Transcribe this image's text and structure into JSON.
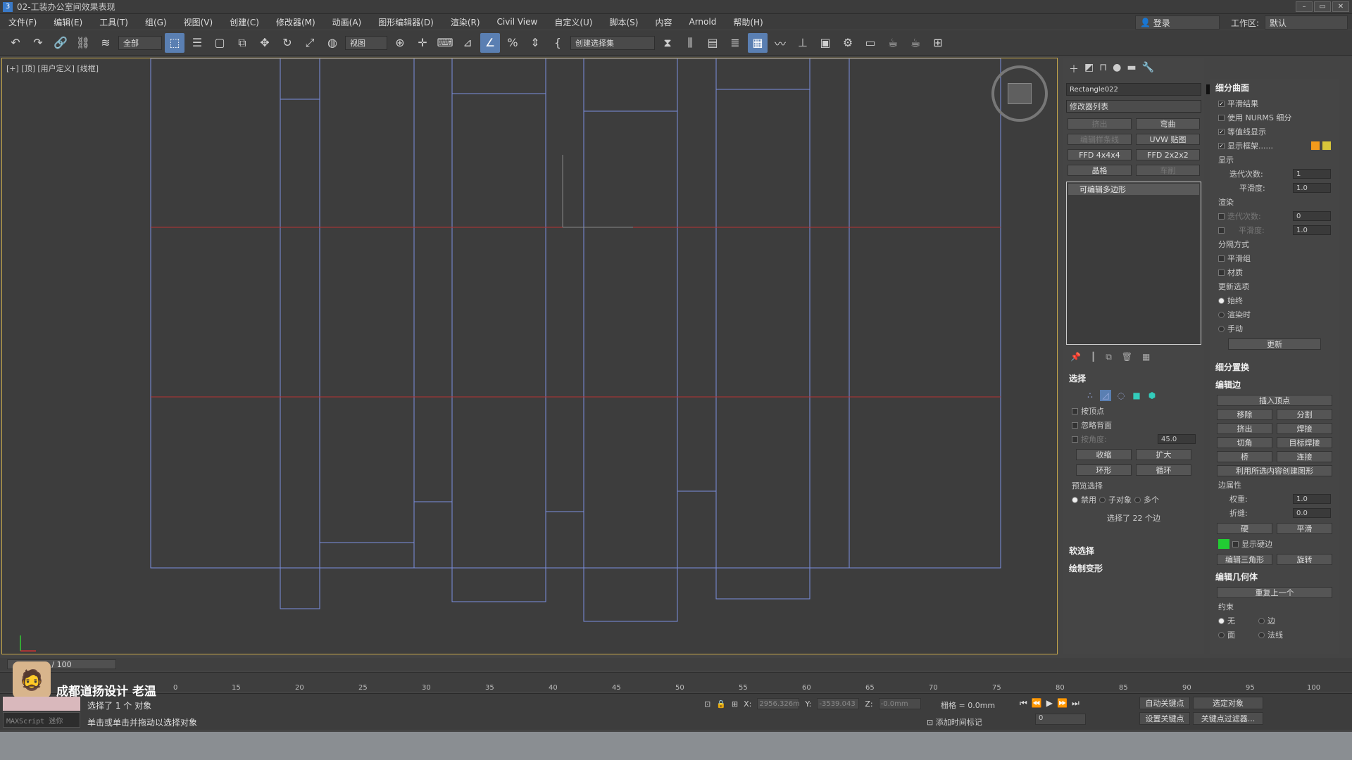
{
  "window": {
    "title": "02-工装办公室间效果表现",
    "app_icon": "3"
  },
  "menu": [
    "文件(F)",
    "编辑(E)",
    "工具(T)",
    "组(G)",
    "视图(V)",
    "创建(C)",
    "修改器(M)",
    "动画(A)",
    "图形编辑器(D)",
    "渲染(R)",
    "Civil View",
    "自定义(U)",
    "脚本(S)",
    "内容",
    "Arnold",
    "帮助(H)"
  ],
  "account": {
    "login": "登录",
    "workspace_label": "工作区:",
    "workspace_value": "默认"
  },
  "toolbar": {
    "filter": "全部",
    "refcoord": "视图",
    "named_selset": "创建选择集"
  },
  "viewport": {
    "label": "[+] [顶] [用户定义] [线框]"
  },
  "modify_panel": {
    "object_name": "Rectangle022",
    "modifier_list": "修改器列表",
    "buttons": [
      "挤出",
      "弯曲",
      "编辑样条线",
      "UVW 贴图",
      "FFD 4x4x4",
      "FFD 2x2x2",
      "晶格",
      "车削"
    ],
    "stack_item": "可编辑多边形"
  },
  "selection": {
    "title": "选择",
    "by_vertex": "按顶点",
    "ignore_backface": "忽略背面",
    "by_angle": "按角度:",
    "angle_value": "45.0",
    "shrink": "收缩",
    "grow": "扩大",
    "ring": "环形",
    "loop": "循环",
    "preview": "预览选择",
    "opt_disable": "禁用",
    "opt_subobj": "子对象",
    "opt_multi": "多个",
    "status": "选择了 22 个边"
  },
  "soft_select": "软选择",
  "paint_deform": "绘制变形",
  "subdiv": {
    "title": "细分曲面",
    "smooth_result": "平滑结果",
    "use_nurms": "使用 NURMS 细分",
    "isoline": "等值线显示",
    "show_cage": "显示框架......",
    "display": "显示",
    "iterations": "迭代次数:",
    "iter_value": "1",
    "smoothness": "平滑度:",
    "smooth_value": "1.0",
    "render": "渲染",
    "r_iter_value": "0",
    "r_smooth_value": "1.0",
    "sep_by": "分隔方式",
    "smooth_groups": "平滑组",
    "materials": "材质",
    "update_opts": "更新选项",
    "always": "始终",
    "when_render": "渲染时",
    "manual": "手动",
    "update_btn": "更新"
  },
  "subdiv_displace": "细分置换",
  "edit_edges": {
    "title": "编辑边",
    "insert_vertex": "插入顶点",
    "remove": "移除",
    "split": "分割",
    "extrude": "挤出",
    "weld": "焊接",
    "chamfer": "切角",
    "target_weld": "目标焊接",
    "bridge": "桥",
    "connect": "连接",
    "create_shape": "利用所选内容创建图形",
    "edge_props": "边属性",
    "weight": "权重:",
    "weight_value": "1.0",
    "crease": "折缝:",
    "crease_value": "0.0",
    "hard": "硬",
    "smooth": "平滑",
    "show_hard": "显示硬边",
    "edit_tri": "编辑三角形",
    "turn": "旋转"
  },
  "edit_geom": {
    "title": "编辑几何体",
    "repeat_last": "重复上一个",
    "constraints": "约束",
    "none": "无",
    "edge": "边",
    "face": "面",
    "normal": "法线"
  },
  "timeline": {
    "slider": "/ 100",
    "ticks": [
      "0",
      "15",
      "20",
      "25",
      "30",
      "35",
      "40",
      "45",
      "50",
      "55",
      "60",
      "65",
      "70",
      "75",
      "80",
      "85",
      "90",
      "95",
      "100"
    ]
  },
  "status": {
    "brand": "成都道扬设计  老温",
    "selected": "选择了 1 个 对象",
    "prompt": "单击或单击并拖动以选择对象",
    "maxscript": "MAXScript 迷你",
    "x_label": "X:",
    "x_value": "2956.326m",
    "y_label": "Y:",
    "y_value": "-3539.043",
    "z_label": "Z:",
    "z_value": "-0.0mm",
    "grid": "栅格 = 0.0mm",
    "add_time_tag": "添加时间标记",
    "frame_value": "0",
    "auto_key": "自动关键点",
    "selected_obj": "选定对象",
    "set_key": "设置关键点",
    "key_filters": "关键点过滤器..."
  },
  "colors": {
    "viewport_border": "#c9a94a",
    "edges": "#7a8fe0",
    "red_lines": "#b83232",
    "accent": "#5a7fb2",
    "hard_edge_color": "#22cc33",
    "cage_color1": "#f39a1c",
    "cage_color2": "#d8c63a"
  }
}
